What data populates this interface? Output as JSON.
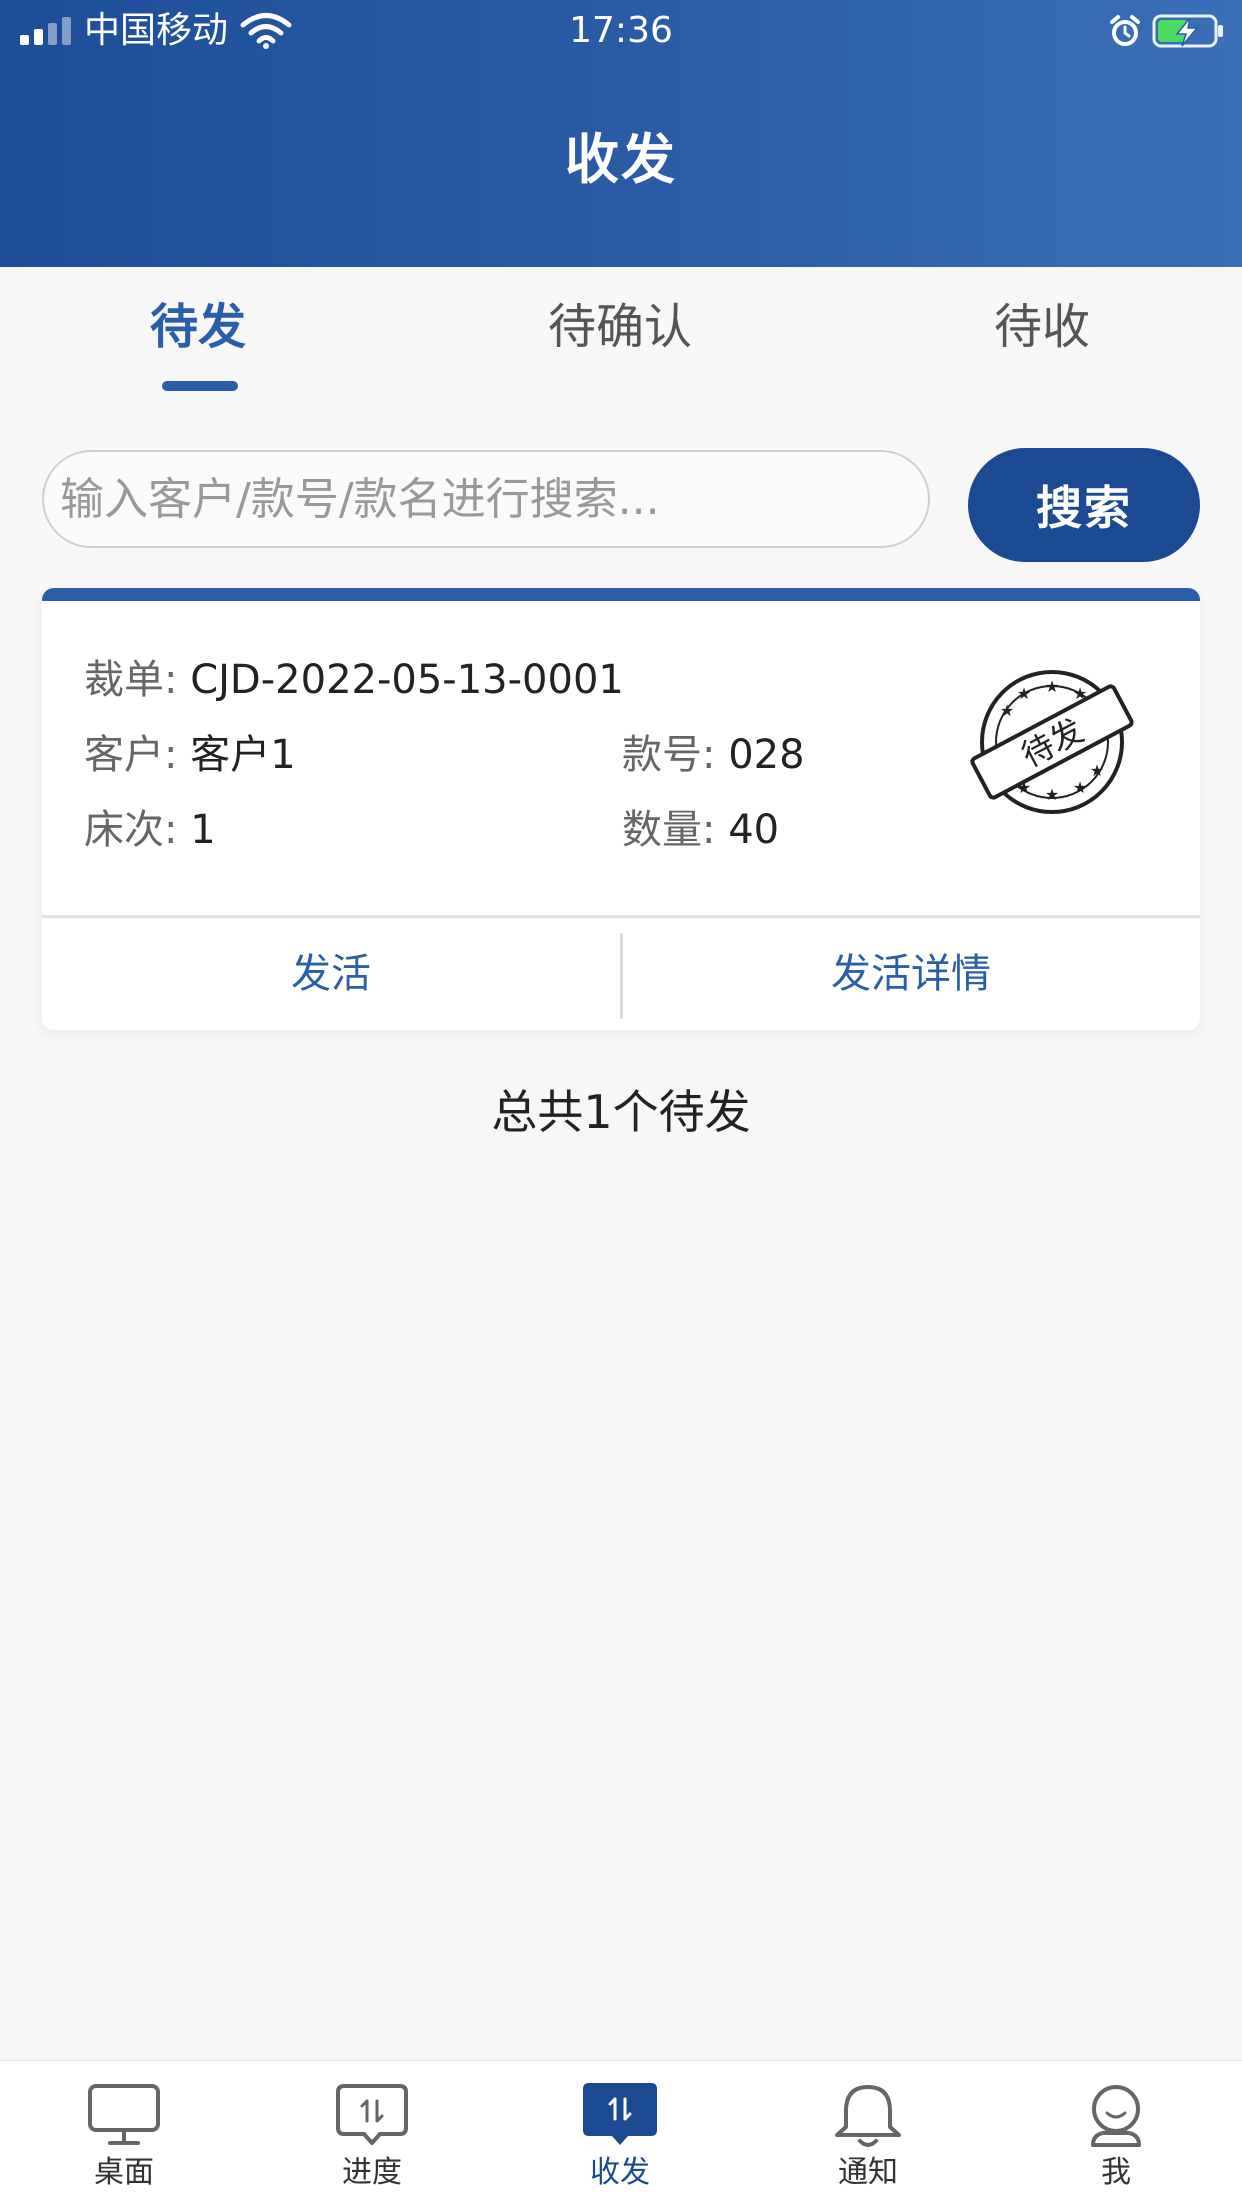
{
  "status_bar": {
    "carrier": "中国移动",
    "time": "17:36"
  },
  "header": {
    "title": "收发"
  },
  "tabs": [
    {
      "label": "待发",
      "active": true
    },
    {
      "label": "待确认",
      "active": false
    },
    {
      "label": "待收",
      "active": false
    }
  ],
  "search": {
    "placeholder": "输入客户/款号/款名进行搜索...",
    "button_label": "搜索"
  },
  "card": {
    "order_label": "裁单:",
    "order_value": "CJD-2022-05-13-0001",
    "customer_label": "客户:",
    "customer_value": "客户1",
    "style_label": "款号:",
    "style_value": "028",
    "bed_label": "床次:",
    "bed_value": "1",
    "qty_label": "数量:",
    "qty_value": "40",
    "stamp_text": "待发",
    "action_send": "发活",
    "action_detail": "发活详情"
  },
  "summary": {
    "total_text": "总共1个待发"
  },
  "bottom_nav": [
    {
      "label": "桌面",
      "icon": "desktop-icon",
      "active": false
    },
    {
      "label": "进度",
      "icon": "progress-icon",
      "active": false
    },
    {
      "label": "收发",
      "icon": "transfer-icon",
      "active": true
    },
    {
      "label": "通知",
      "icon": "bell-icon",
      "active": false
    },
    {
      "label": "我",
      "icon": "profile-icon",
      "active": false
    }
  ],
  "colors": {
    "primary": "#1c4a92",
    "accent": "#2a5ea8",
    "battery_fill": "#4cd964"
  }
}
